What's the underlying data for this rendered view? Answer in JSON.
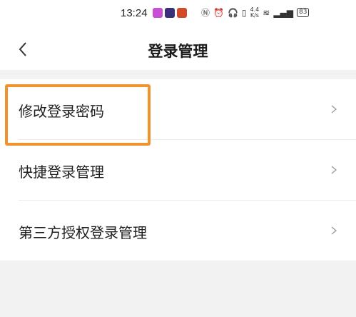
{
  "status_bar": {
    "time": "13:24",
    "net_speed_value": "4.4",
    "net_speed_unit": "K/s",
    "battery": "83"
  },
  "header": {
    "title": "登录管理",
    "back_icon": "chevron-left-icon"
  },
  "menu": {
    "items": [
      {
        "label": "修改登录密码"
      },
      {
        "label": "快捷登录管理"
      },
      {
        "label": "第三方授权登录管理"
      }
    ]
  },
  "colors": {
    "highlight": "#f0932e",
    "background": "#f2f2f2"
  }
}
